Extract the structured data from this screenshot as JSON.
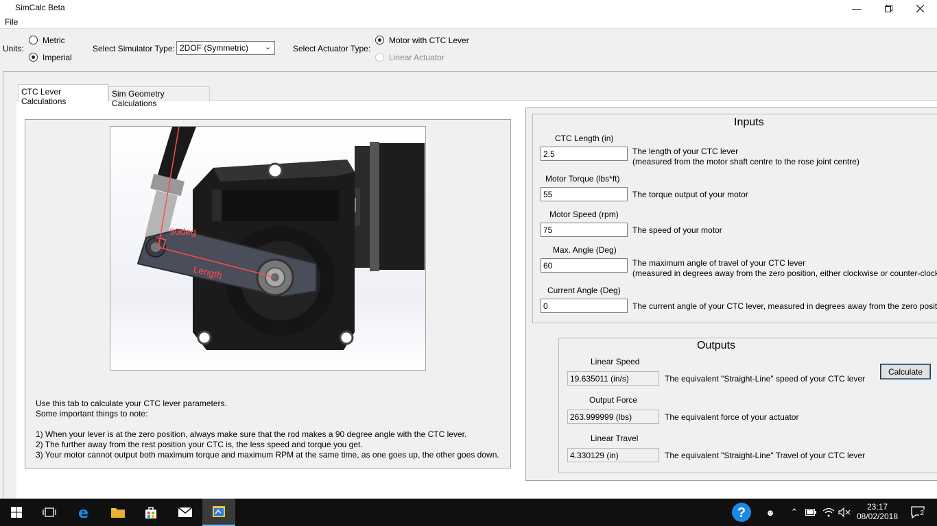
{
  "window": {
    "title": "SimCalc Beta"
  },
  "menu": {
    "file": "File"
  },
  "toolbar": {
    "units_label": "Units:",
    "unit_metric": "Metric",
    "unit_imperial": "Imperial",
    "sim_type_label": "Select Simulator Type:",
    "sim_type_value": "2DOF (Symmetric)",
    "actuator_label": "Select Actuator Type:",
    "actuator_motor": "Motor with CTC Lever",
    "actuator_linear": "Linear Actuator"
  },
  "tabs": {
    "ctc": "CTC Lever Calculations",
    "geometry": "Sim Geometry Calculations"
  },
  "image": {
    "angle_label": "90deg",
    "length_label": "Length"
  },
  "instructions": {
    "line1": "Use this tab to calculate your CTC lever parameters.",
    "line2": "Some important things to note:",
    "note1": "1) When your lever is at the zero position, always make sure that the rod makes a 90 degree angle with the CTC lever.",
    "note2": "2) The further away from the rest position your CTC is, the less speed and torque you get.",
    "note3": "3) Your motor cannot output both maximum torque and maximum RPM at the same time, as one goes up, the other goes down."
  },
  "inputs": {
    "title": "Inputs",
    "ctc_length": {
      "label": "CTC Length  (in)",
      "value": "2.5",
      "desc1": "The length of your CTC lever",
      "desc2": "(measured from the motor shaft centre to the rose joint centre)"
    },
    "motor_torque": {
      "label": "Motor Torque  (lbs*ft)",
      "value": "55",
      "desc1": "The torque output of your motor"
    },
    "motor_speed": {
      "label": "Motor Speed  (rpm)",
      "value": "75",
      "desc1": "The speed of your motor"
    },
    "max_angle": {
      "label": "Max. Angle  (Deg)",
      "value": "60",
      "desc1": "The maximum angle of travel of your CTC lever",
      "desc2": "(measured in degrees away from the zero position, either clockwise or counter-clockwise)"
    },
    "current_angle": {
      "label": "Current Angle  (Deg)",
      "value": "0",
      "desc1": "The current angle of your CTC lever, measured in degrees away from the zero position"
    }
  },
  "outputs": {
    "title": "Outputs",
    "linear_speed": {
      "label": "Linear Speed",
      "value": "19.635011   (in/s)",
      "desc": "The equivalent \"Straight-Line\" speed of your CTC lever"
    },
    "output_force": {
      "label": "Output Force",
      "value": "263.999999   (lbs)",
      "desc": "The equivalent force of your actuator"
    },
    "linear_travel": {
      "label": "Linear Travel",
      "value": "4.330129   (in)",
      "desc": "The equivalent \"Straight-Line\" Travel of your CTC lever"
    },
    "calculate": "Calculate"
  },
  "taskbar": {
    "time": "23:17",
    "date": "08/02/2018",
    "notifications": "2"
  },
  "colors": {
    "accent": "#0078d7",
    "annotation_red": "#ff4d4d",
    "taskbar": "#101010"
  }
}
